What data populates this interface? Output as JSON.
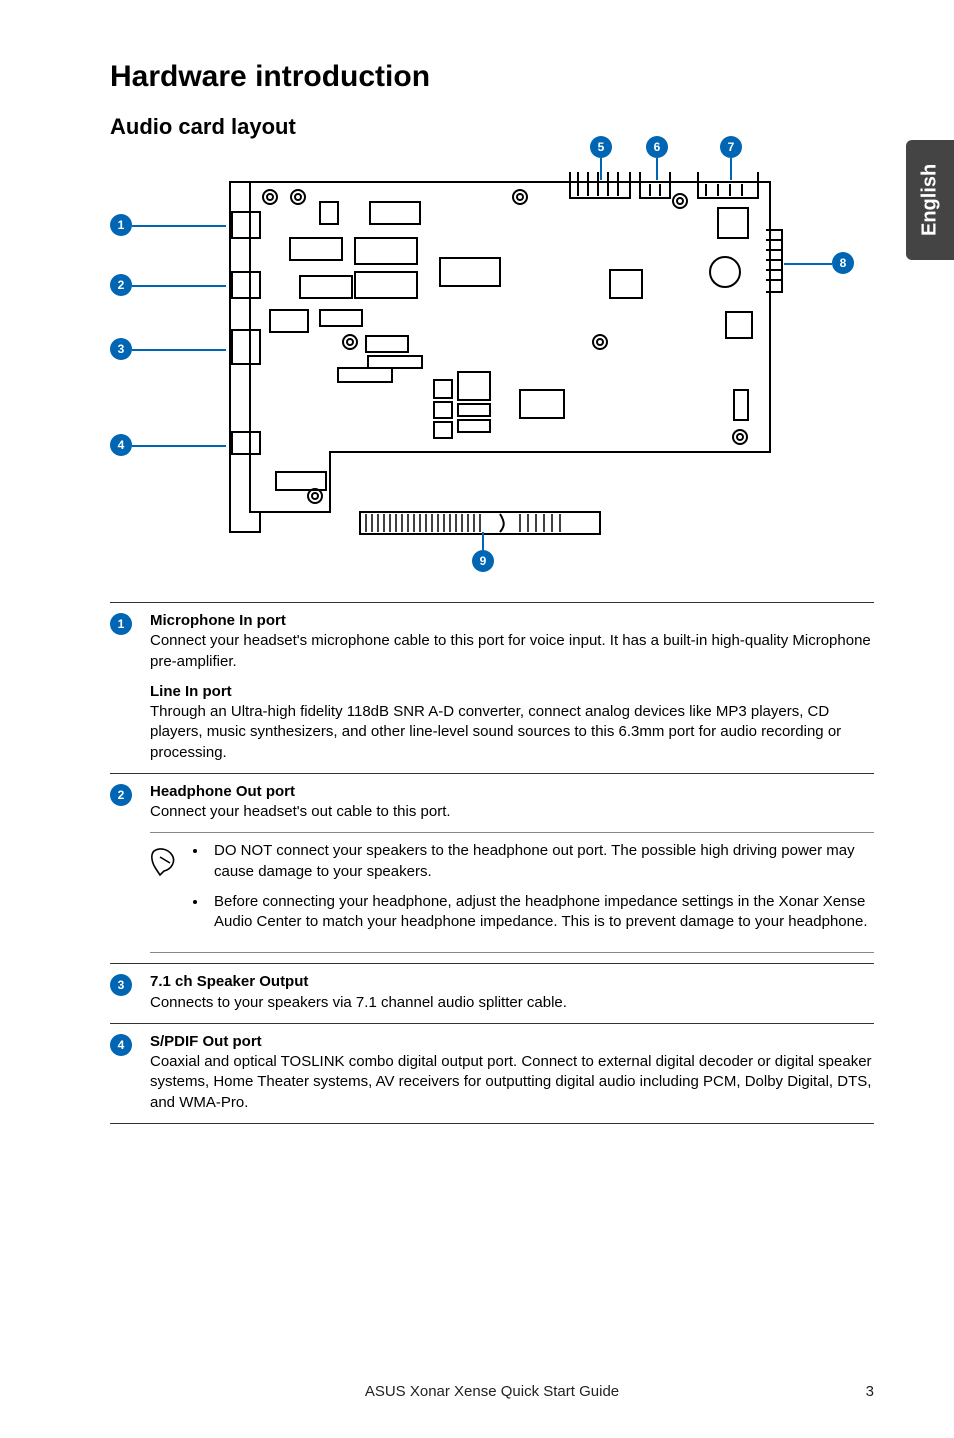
{
  "side_tab": "English",
  "page_title": "Hardware introduction",
  "subtitle": "Audio card layout",
  "callouts": {
    "c1": "1",
    "c2": "2",
    "c3": "3",
    "c4": "4",
    "c5": "5",
    "c6": "6",
    "c7": "7",
    "c8": "8",
    "c9": "9"
  },
  "items": [
    {
      "badge": "1",
      "sections": [
        {
          "title": "Microphone In port",
          "desc": "Connect your headset's microphone cable to this port for voice input. It has a built-in high-quality Microphone pre-amplifier."
        },
        {
          "title": "Line In port",
          "desc": "Through an Ultra-high fidelity 118dB SNR A-D converter, connect analog devices like MP3 players, CD players, music synthesizers, and other line-level sound sources to this 6.3mm port for audio recording or processing."
        }
      ]
    },
    {
      "badge": "2",
      "sections": [
        {
          "title": "Headphone Out port",
          "desc": "Connect your headset's out cable to this port."
        }
      ],
      "notes": [
        "DO NOT connect your speakers to the headphone out port. The possible high driving power may cause damage to your speakers.",
        "Before connecting your headphone, adjust the headphone impedance settings in the Xonar Xense Audio Center to match your headphone impedance. This is to prevent damage to your headphone."
      ]
    },
    {
      "badge": "3",
      "sections": [
        {
          "title": "7.1 ch Speaker Output",
          "desc": "Connects to your speakers via 7.1 channel audio splitter cable."
        }
      ]
    },
    {
      "badge": "4",
      "sections": [
        {
          "title": "S/PDIF Out port",
          "desc": "Coaxial and optical TOSLINK combo digital output port. Connect to external digital decoder or digital speaker systems, Home Theater systems, AV receivers for outputting digital audio including PCM, Dolby Digital, DTS, and WMA-Pro."
        }
      ]
    }
  ],
  "footer_center": "ASUS Xonar Xense Quick Start Guide",
  "footer_right": "3"
}
